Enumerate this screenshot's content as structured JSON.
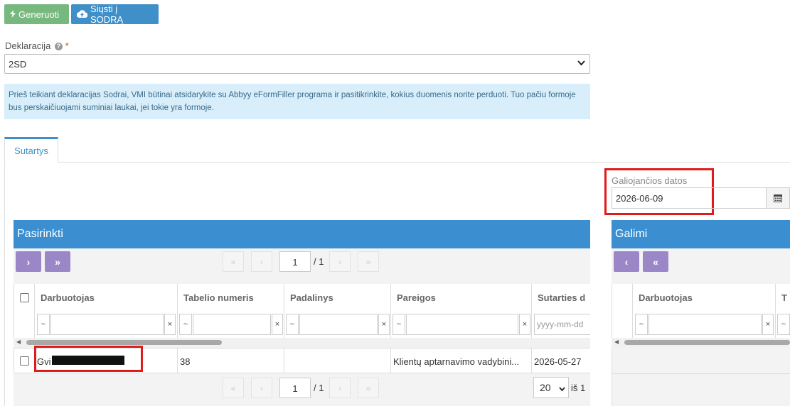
{
  "toolbar": {
    "generate_label": "Generuoti",
    "send_label": "Siųsti į SODRĄ"
  },
  "declaration": {
    "label": "Deklaracija",
    "required_mark": "*",
    "selected": "2SD"
  },
  "info_text": "Prieš teikiant deklaracijas Sodrai, VMI būtinai atsidarykite su Abbyy eFormFiller programa ir pasitikrinkite, kokius duomenis norite perduoti. Tuo pačiu formoje bus perskaičiuojami suminiai laukai, jei tokie yra formoje.",
  "tabs": [
    {
      "label": "Sutartys"
    }
  ],
  "validity": {
    "label": "Galiojančios datos",
    "value": "2026-06-09"
  },
  "selected_panel": {
    "title": "Pasirinkti",
    "page_value": "1",
    "page_total": "/ 1",
    "columns": [
      "Darbuotojas",
      "Tabelio numeris",
      "Padalinys",
      "Pareigos",
      "Sutarties d"
    ],
    "date_placeholder": "yyyy-mm-dd",
    "rows": [
      {
        "employee": "Gvi",
        "tab_no": "38",
        "unit": "",
        "position": "Klientų aptarnavimo vadybini...",
        "date": "2026-05-27"
      }
    ],
    "bottom_page_value": "1",
    "bottom_page_total": "/ 1",
    "page_size": "20",
    "of_text": "iš 1"
  },
  "available_panel": {
    "title": "Galimi",
    "columns": [
      "Darbuotojas",
      "T"
    ]
  },
  "icons": {
    "filter_op": "~",
    "filter_clear": "×"
  }
}
